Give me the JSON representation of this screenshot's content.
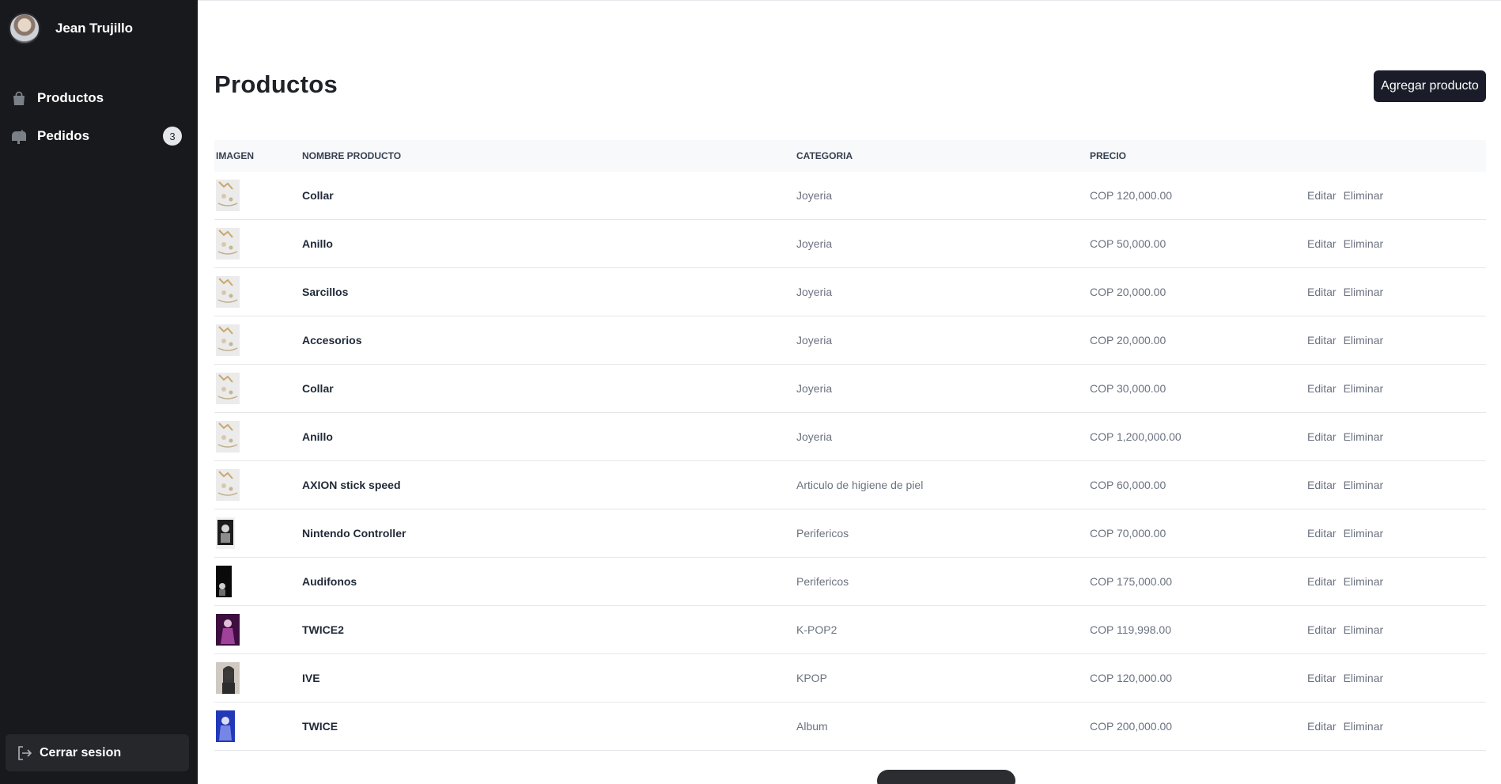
{
  "user": {
    "name": "Jean Trujillo"
  },
  "nav": {
    "items": [
      {
        "label": "Productos",
        "icon": "shopping-bag-icon"
      },
      {
        "label": "Pedidos",
        "icon": "mailbox-icon",
        "badge": "3"
      }
    ],
    "logout_label": "Cerrar sesion"
  },
  "page": {
    "title": "Productos",
    "add_button": "Agregar producto"
  },
  "table": {
    "headers": [
      "IMAGEN",
      "NOMBRE PRODUCTO",
      "CATEGORIA",
      "PRECIO"
    ],
    "actions": {
      "edit": "Editar",
      "delete": "Eliminar"
    },
    "rows": [
      {
        "name": "Collar",
        "category": "Joyeria",
        "price": "COP 120,000.00",
        "thumb": "jewelry"
      },
      {
        "name": "Anillo",
        "category": "Joyeria",
        "price": "COP 50,000.00",
        "thumb": "jewelry"
      },
      {
        "name": "Sarcillos",
        "category": "Joyeria",
        "price": "COP 20,000.00",
        "thumb": "jewelry"
      },
      {
        "name": "Accesorios",
        "category": "Joyeria",
        "price": "COP 20,000.00",
        "thumb": "jewelry"
      },
      {
        "name": "Collar",
        "category": "Joyeria",
        "price": "COP 30,000.00",
        "thumb": "jewelry"
      },
      {
        "name": "Anillo",
        "category": "Joyeria",
        "price": "COP 1,200,000.00",
        "thumb": "jewelry"
      },
      {
        "name": "AXION stick speed",
        "category": "Articulo de higiene de piel",
        "price": "COP 60,000.00",
        "thumb": "jewelry"
      },
      {
        "name": "Nintendo Controller",
        "category": "Perifericos",
        "price": "COP 70,000.00",
        "thumb": "bw-photo"
      },
      {
        "name": "Audifonos",
        "category": "Perifericos",
        "price": "COP 175,000.00",
        "thumb": "dark-photo"
      },
      {
        "name": "TWICE2",
        "category": "K-POP2",
        "price": "COP 119,998.00",
        "thumb": "purple-photo"
      },
      {
        "name": "IVE",
        "category": "KPOP",
        "price": "COP 120,000.00",
        "thumb": "portrait-photo"
      },
      {
        "name": "TWICE",
        "category": "Album",
        "price": "COP 200,000.00",
        "thumb": "blue-photo"
      }
    ]
  },
  "colors": {
    "sidebar_bg": "#18191c",
    "button_bg": "#1a1d29",
    "header_bg": "#f8f9fa"
  }
}
